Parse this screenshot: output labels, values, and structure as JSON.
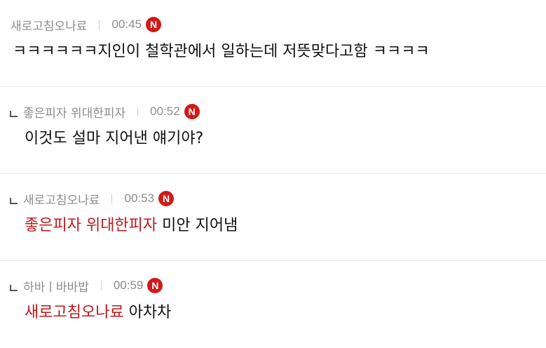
{
  "comments": [
    {
      "author": "새로고침오나료",
      "time": "00:45",
      "badge": "N",
      "mention": "",
      "text": "ㅋㅋㅋㅋㅋㅋ지인이 철학관에서 일하는데 저뜻맞다고함 ㅋㅋㅋㅋ"
    },
    {
      "author": "좋은피자 위대한피자",
      "time": "00:52",
      "badge": "N",
      "mention": "",
      "text": "이것도 설마 지어낸 얘기야?"
    },
    {
      "author": "새로고침오나료",
      "time": "00:53",
      "badge": "N",
      "mention": "좋은피자 위대한피자",
      "text": "미안 지어냄"
    },
    {
      "author": "하바ㅣ바바밥",
      "time": "00:59",
      "badge": "N",
      "mention": "새로고침오나료",
      "text": "아차차"
    }
  ],
  "colors": {
    "mention": "#c0161b",
    "badge": "#d11a1a",
    "meta_text": "#8c8c8c"
  }
}
